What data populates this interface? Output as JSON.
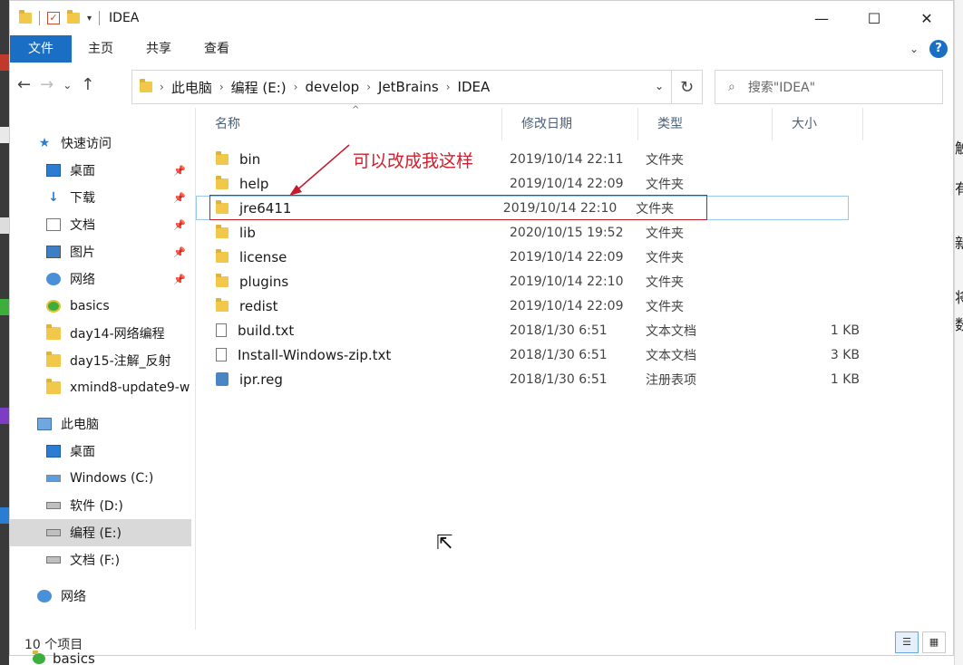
{
  "window": {
    "title": "IDEA"
  },
  "title_buttons": {
    "minimize": "—",
    "maximize": "☐",
    "close": "✕"
  },
  "ribbon": {
    "tabs": [
      "文件",
      "主页",
      "共享",
      "查看"
    ],
    "help": "?"
  },
  "address": {
    "crumbs": [
      "此电脑",
      "编程 (E:)",
      "develop",
      "JetBrains",
      "IDEA"
    ]
  },
  "search": {
    "placeholder": "搜索\"IDEA\""
  },
  "nav_pane": {
    "quick_access": "快速访问",
    "quick_items": [
      {
        "label": "桌面",
        "icon": "desktop-icon"
      },
      {
        "label": "下载",
        "icon": "download-icon"
      },
      {
        "label": "文档",
        "icon": "document-icon"
      },
      {
        "label": "图片",
        "icon": "picture-icon"
      },
      {
        "label": "网络",
        "icon": "network-icon"
      },
      {
        "label": "basics",
        "icon": "folder-icon"
      },
      {
        "label": "day14-网络编程",
        "icon": "folder-icon"
      },
      {
        "label": "day15-注解_反射",
        "icon": "folder-icon"
      },
      {
        "label": "xmind8-update9-w",
        "icon": "folder-icon"
      }
    ],
    "this_pc": "此电脑",
    "pc_items": [
      {
        "label": "桌面"
      },
      {
        "label": "Windows (C:)"
      },
      {
        "label": "软件 (D:)"
      },
      {
        "label": "编程 (E:)",
        "selected": true
      },
      {
        "label": "文档 (F:)"
      }
    ],
    "network": "网络"
  },
  "columns": [
    "名称",
    "修改日期",
    "类型",
    "大小"
  ],
  "files": [
    {
      "name": "bin",
      "date": "2019/10/14 22:11",
      "type": "文件夹",
      "size": "",
      "kind": "folder"
    },
    {
      "name": "help",
      "date": "2019/10/14 22:09",
      "type": "文件夹",
      "size": "",
      "kind": "folder"
    },
    {
      "name": "jre6411",
      "date": "2019/10/14 22:10",
      "type": "文件夹",
      "size": "",
      "kind": "folder",
      "selected": true
    },
    {
      "name": "lib",
      "date": "2020/10/15 19:52",
      "type": "文件夹",
      "size": "",
      "kind": "folder"
    },
    {
      "name": "license",
      "date": "2019/10/14 22:09",
      "type": "文件夹",
      "size": "",
      "kind": "folder"
    },
    {
      "name": "plugins",
      "date": "2019/10/14 22:10",
      "type": "文件夹",
      "size": "",
      "kind": "folder"
    },
    {
      "name": "redist",
      "date": "2019/10/14 22:09",
      "type": "文件夹",
      "size": "",
      "kind": "folder"
    },
    {
      "name": "build.txt",
      "date": "2018/1/30 6:51",
      "type": "文本文档",
      "size": "1 KB",
      "kind": "text"
    },
    {
      "name": "Install-Windows-zip.txt",
      "date": "2018/1/30 6:51",
      "type": "文本文档",
      "size": "3 KB",
      "kind": "text"
    },
    {
      "name": "ipr.reg",
      "date": "2018/1/30 6:51",
      "type": "注册表项",
      "size": "1 KB",
      "kind": "registry"
    }
  ],
  "annotation": {
    "text": "可以改成我这样",
    "color": "#d0202e"
  },
  "status": {
    "count": "10 个项目"
  },
  "peek": {
    "label": "basics"
  },
  "colors": {
    "accent": "#1a6fc4",
    "annotation": "#c41a2a"
  }
}
